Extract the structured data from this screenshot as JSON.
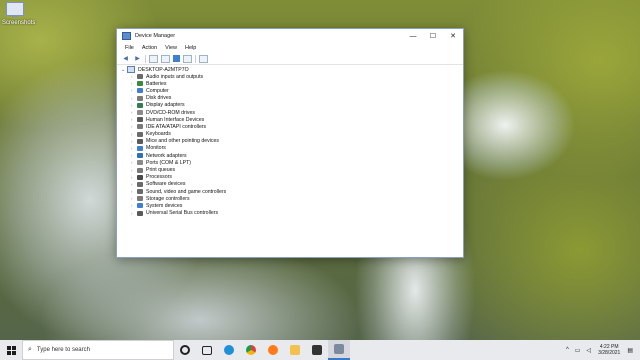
{
  "desktop": {
    "icon_label": "Screenshots"
  },
  "window": {
    "title": "Device Manager",
    "controls": {
      "minimize": "—",
      "maximize": "☐",
      "close": "✕"
    }
  },
  "menu": [
    "File",
    "Action",
    "View",
    "Help"
  ],
  "tree": {
    "root": "DESKTOP-A2MTP7O",
    "items": [
      {
        "label": "Audio inputs and outputs",
        "color": "#6a6a6a"
      },
      {
        "label": "Batteries",
        "color": "#3b8a3b"
      },
      {
        "label": "Computer",
        "color": "#3f7fd1"
      },
      {
        "label": "Disk drives",
        "color": "#7a7a7a"
      },
      {
        "label": "Display adapters",
        "color": "#2f7f4f"
      },
      {
        "label": "DVD/CD-ROM drives",
        "color": "#8a8a8a"
      },
      {
        "label": "Human Interface Devices",
        "color": "#5a5a5a"
      },
      {
        "label": "IDE ATA/ATAPI controllers",
        "color": "#7a7a7a"
      },
      {
        "label": "Keyboards",
        "color": "#6a6a6a"
      },
      {
        "label": "Mice and other pointing devices",
        "color": "#5a5a5a"
      },
      {
        "label": "Monitors",
        "color": "#3f7fd1"
      },
      {
        "label": "Network adapters",
        "color": "#2f6fb0"
      },
      {
        "label": "Ports (COM & LPT)",
        "color": "#8a8a8a"
      },
      {
        "label": "Print queues",
        "color": "#7a7a7a"
      },
      {
        "label": "Processors",
        "color": "#4a4a4a"
      },
      {
        "label": "Software devices",
        "color": "#6a6a6a"
      },
      {
        "label": "Sound, video and game controllers",
        "color": "#6a6a6a"
      },
      {
        "label": "Storage controllers",
        "color": "#7a7a7a"
      },
      {
        "label": "System devices",
        "color": "#3f7fd1"
      },
      {
        "label": "Universal Serial Bus controllers",
        "color": "#5a5a5a"
      }
    ]
  },
  "taskbar": {
    "search_placeholder": "Type here to search",
    "clock_time": "4:22 PM",
    "clock_date": "3/28/2021"
  }
}
